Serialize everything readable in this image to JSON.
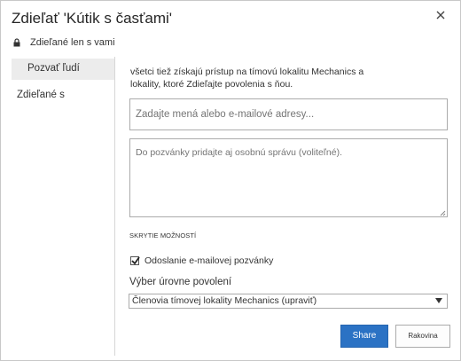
{
  "dialog": {
    "title": "Zdieľať 'Kútik s časťami'",
    "shared_status": "Zdieľané len s vami"
  },
  "sidebar": {
    "items": [
      {
        "label": "Pozvať ľudí",
        "active": true
      },
      {
        "label": "Zdieľané s",
        "active": false
      }
    ]
  },
  "main": {
    "info_text": "všetci tiež získajú prístup na tímovú lokalitu Mechanics a lokality, ktoré Zdieľajte povolenia s ňou.",
    "people_input": {
      "placeholder": "Zadajte mená alebo e-mailové adresy..."
    },
    "message": {
      "placeholder": "Do pozvánky pridajte aj osobnú správu (voliteľné)."
    },
    "hide_options_label": "SKRYTIE MOŽNOSTÍ",
    "send_email": {
      "label": "Odoslanie e-mailovej pozvánky",
      "checked": true
    },
    "permission": {
      "label": "Výber úrovne povolení",
      "selected": "Členovia tímovej lokality Mechanics (upraviť)"
    }
  },
  "buttons": {
    "share": "Share",
    "cancel": "Rakovina"
  },
  "colors": {
    "primary_button": "#2b72c4",
    "border": "#ababab"
  },
  "icons": [
    "close-icon",
    "lock-icon",
    "checkmark-icon",
    "chevron-down-icon",
    "resize-grip-icon"
  ]
}
